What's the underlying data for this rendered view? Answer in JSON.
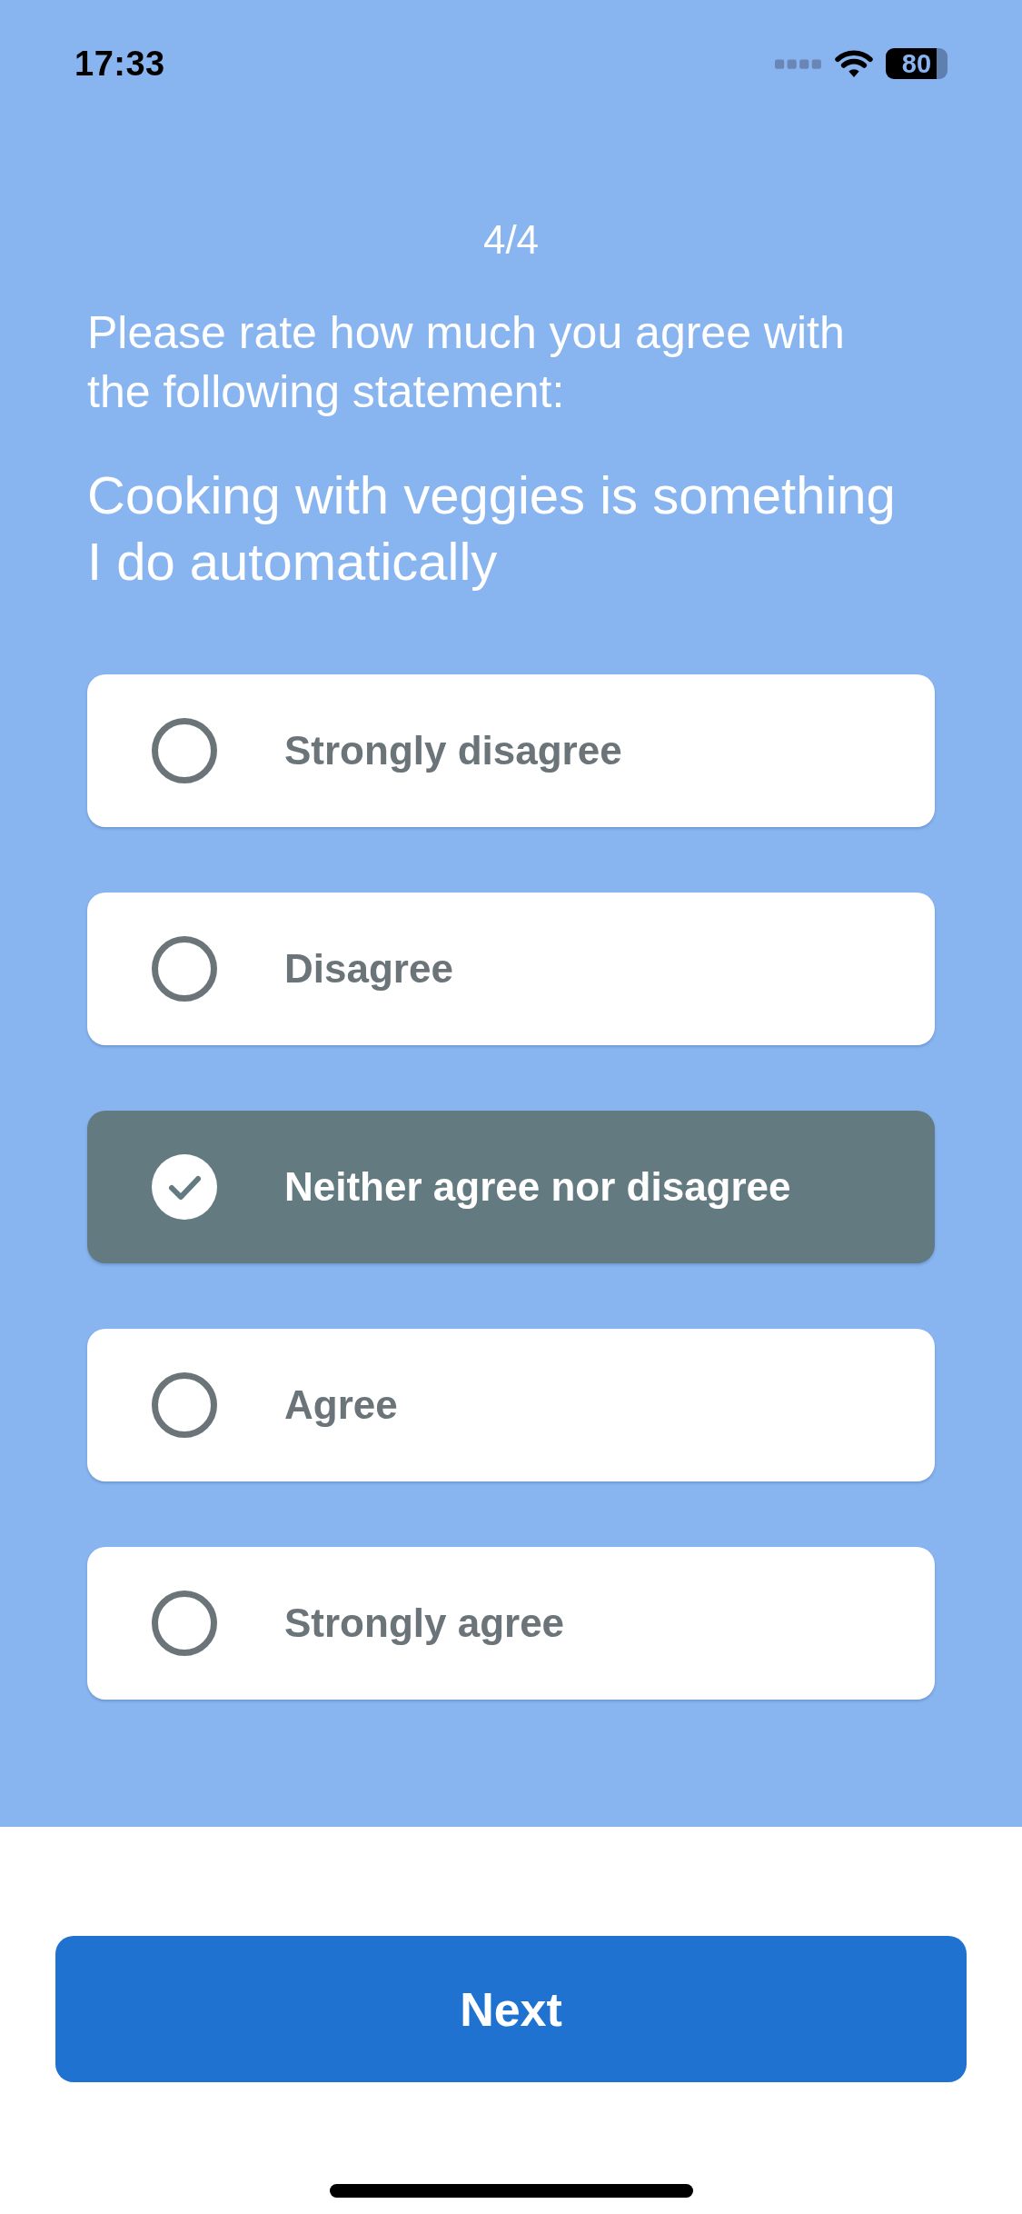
{
  "status_bar": {
    "time": "17:33",
    "battery": "80"
  },
  "progress": "4/4",
  "prompt": "Please rate how much you agree with the following statement:",
  "statement": "Cooking with veggies is something I do automatically",
  "options": [
    {
      "label": "Strongly disagree",
      "selected": false
    },
    {
      "label": "Disagree",
      "selected": false
    },
    {
      "label": "Neither agree nor disagree",
      "selected": true
    },
    {
      "label": "Agree",
      "selected": false
    },
    {
      "label": "Strongly agree",
      "selected": false
    }
  ],
  "next_button": {
    "label": "Next"
  }
}
